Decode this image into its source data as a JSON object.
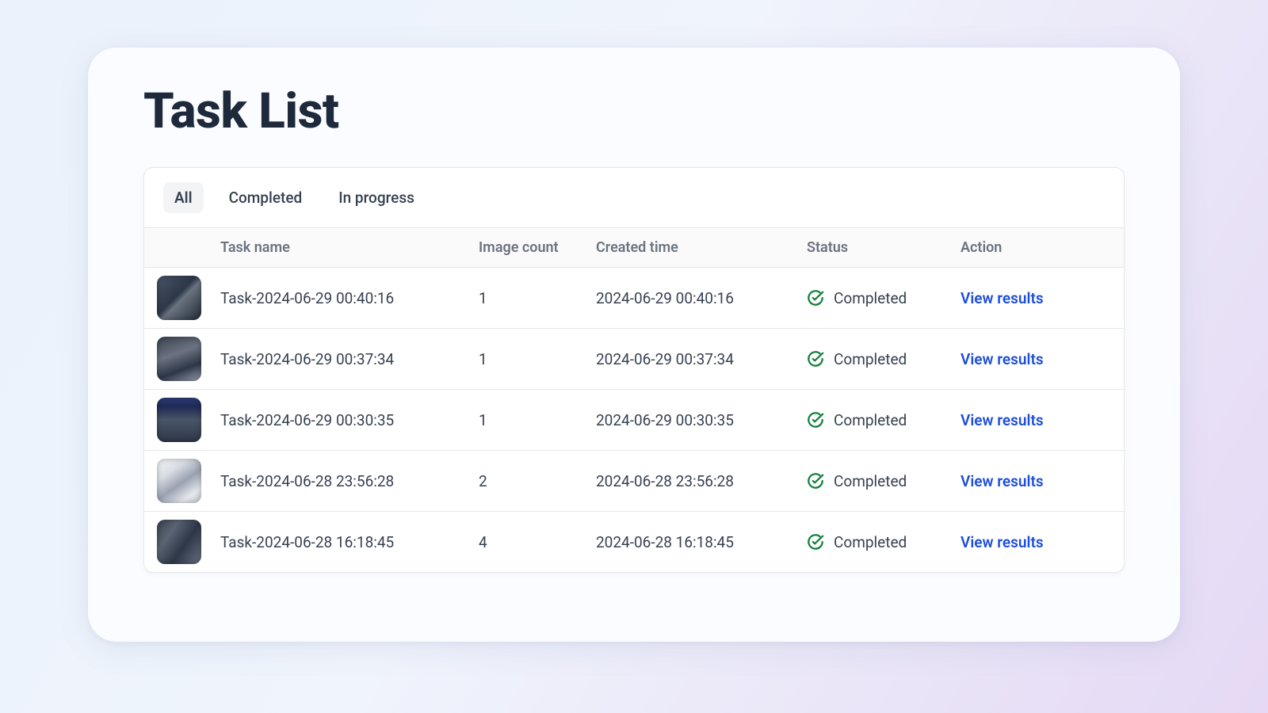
{
  "page_title": "Task List",
  "tabs": {
    "all": "All",
    "completed": "Completed",
    "in_progress": "In progress"
  },
  "columns": {
    "task_name": "Task name",
    "image_count": "Image count",
    "created_time": "Created time",
    "status": "Status",
    "action": "Action"
  },
  "status_label": "Completed",
  "action_label": "View results",
  "rows": [
    {
      "task_name": "Task-2024-06-29 00:40:16",
      "image_count": "1",
      "created_time": "2024-06-29 00:40:16"
    },
    {
      "task_name": "Task-2024-06-29 00:37:34",
      "image_count": "1",
      "created_time": "2024-06-29 00:37:34"
    },
    {
      "task_name": "Task-2024-06-29 00:30:35",
      "image_count": "1",
      "created_time": "2024-06-29 00:30:35"
    },
    {
      "task_name": "Task-2024-06-28 23:56:28",
      "image_count": "2",
      "created_time": "2024-06-28 23:56:28"
    },
    {
      "task_name": "Task-2024-06-28 16:18:45",
      "image_count": "4",
      "created_time": "2024-06-28 16:18:45"
    }
  ]
}
